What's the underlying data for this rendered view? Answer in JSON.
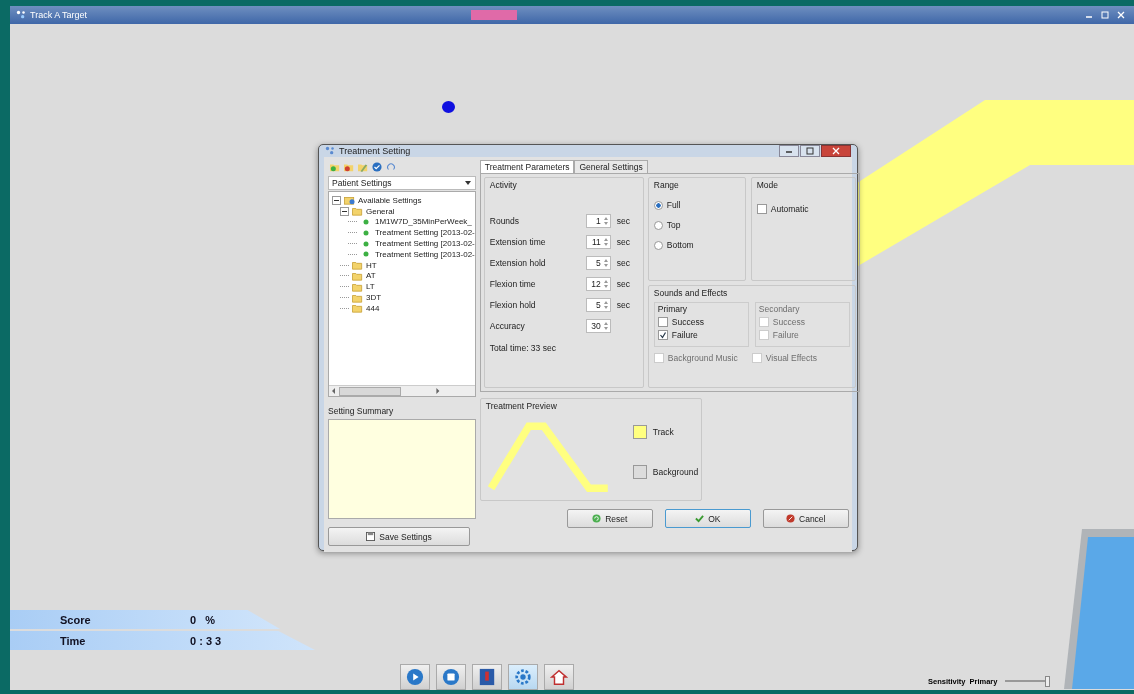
{
  "window": {
    "title": "Track A Target"
  },
  "dialog": {
    "title": "Treatment Setting",
    "settings_dropdown": {
      "value": "Patient Settings"
    },
    "tree": [
      {
        "label": "Available Settings",
        "kind": "root",
        "expanded": true,
        "children": [
          {
            "label": "General",
            "kind": "folder",
            "expanded": true,
            "children": [
              {
                "label": "1M1W7D_35MinPerWeek_",
                "kind": "setting"
              },
              {
                "label": "Treatment Setting [2013-02-",
                "kind": "setting"
              },
              {
                "label": "Treatment Setting [2013-02-",
                "kind": "setting"
              },
              {
                "label": "Treatment Setting [2013-02-",
                "kind": "setting"
              }
            ]
          },
          {
            "label": "HT",
            "kind": "folder"
          },
          {
            "label": "AT",
            "kind": "folder"
          },
          {
            "label": "LT",
            "kind": "folder"
          },
          {
            "label": "3DT",
            "kind": "folder"
          },
          {
            "label": "444",
            "kind": "folder"
          }
        ]
      }
    ],
    "summary_label": "Setting Summary",
    "save_button": "Save Settings",
    "tabs": [
      {
        "label": "Treatment Parameters",
        "selected": true
      },
      {
        "label": "General Settings",
        "selected": false
      }
    ],
    "activity": {
      "title": "Activity",
      "params": [
        {
          "label": "Rounds",
          "value": "1",
          "unit": "sec"
        },
        {
          "label": "Extension time",
          "value": "11",
          "unit": "sec"
        },
        {
          "label": "Extension hold",
          "value": "5",
          "unit": "sec"
        },
        {
          "label": "Flexion time",
          "value": "12",
          "unit": "sec"
        },
        {
          "label": "Flexion hold",
          "value": "5",
          "unit": "sec"
        },
        {
          "label": "Accuracy",
          "value": "30"
        }
      ],
      "total": "Total time: 33 sec"
    },
    "range": {
      "title": "Range",
      "options": [
        {
          "label": "Full",
          "selected": true
        },
        {
          "label": "Top",
          "selected": false
        },
        {
          "label": "Bottom",
          "selected": false
        }
      ]
    },
    "mode": {
      "title": "Mode",
      "options": [
        {
          "label": "Automatic",
          "checked": false
        }
      ]
    },
    "sounds": {
      "title": "Sounds and Effects",
      "groups": [
        {
          "title": "Primary",
          "disabled": false,
          "options": [
            {
              "label": "Success",
              "checked": false
            },
            {
              "label": "Failure",
              "checked": true
            }
          ]
        },
        {
          "title": "Secondary",
          "disabled": true,
          "options": [
            {
              "label": "Success",
              "checked": false
            },
            {
              "label": "Failure",
              "checked": false
            }
          ]
        }
      ],
      "extras": [
        {
          "label": "Background Music",
          "checked": false,
          "disabled": true
        },
        {
          "label": "Visual Effects",
          "checked": false,
          "disabled": true
        }
      ]
    },
    "preview": {
      "title": "Treatment Preview",
      "swatches": [
        {
          "label": "Track",
          "color": "#ffff80"
        },
        {
          "label": "Background",
          "color": "#dcdcdc"
        }
      ]
    },
    "buttons": [
      {
        "label": "Reset",
        "kind": "reset",
        "selected": false
      },
      {
        "label": "OK",
        "kind": "ok",
        "selected": true
      },
      {
        "label": "Cancel",
        "kind": "cancel",
        "selected": false
      }
    ]
  },
  "scoreboard": [
    {
      "label": "Score",
      "value": "0   %"
    },
    {
      "label": "Time",
      "value": "0 : 3 3"
    }
  ],
  "toolbar": [
    {
      "kind": "play",
      "selected": false
    },
    {
      "kind": "stop",
      "selected": false
    },
    {
      "kind": "report",
      "selected": false
    },
    {
      "kind": "settings",
      "selected": true
    },
    {
      "kind": "home",
      "selected": false
    }
  ],
  "sensitivity": {
    "label": "Sensitivity",
    "value": "Primary",
    "level": 0.95
  }
}
